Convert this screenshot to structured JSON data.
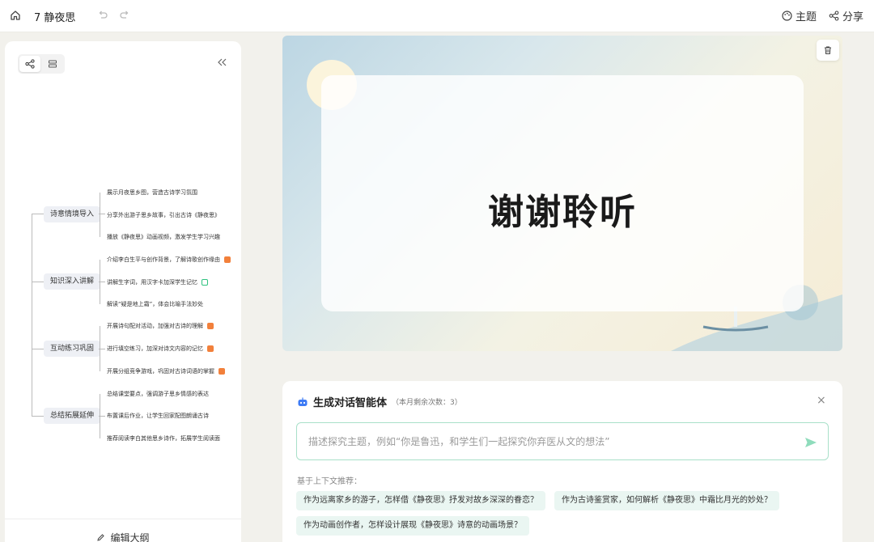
{
  "topbar": {
    "doc_title": "7 静夜思",
    "theme_label": "主题",
    "share_label": "分享"
  },
  "left_panel": {
    "edit_outline_label": "编辑大纲",
    "mindmap": {
      "branches": [
        {
          "label": "诗意情境导入",
          "leaves": [
            {
              "text": "展示月夜思乡图，营造古诗学习氛围",
              "badge": ""
            },
            {
              "text": "分享外出游子思乡故事，引出古诗《静夜思》",
              "badge": ""
            },
            {
              "text": "播放《静夜思》动画视频，激发学生学习兴趣",
              "badge": ""
            }
          ]
        },
        {
          "label": "知识深入讲解",
          "leaves": [
            {
              "text": "介绍李白生平与创作背景，了解诗歌创作缘由",
              "badge": "orange"
            },
            {
              "text": "讲解生字词，用汉字卡加深学生记忆",
              "badge": "green"
            },
            {
              "text": "解读“疑是地上霜”，体会比喻手法妙处",
              "badge": ""
            }
          ]
        },
        {
          "label": "互动练习巩固",
          "leaves": [
            {
              "text": "开展诗句配对活动，加强对古诗的理解",
              "badge": "orange"
            },
            {
              "text": "进行填空练习，加深对诗文内容的记忆",
              "badge": "orange"
            },
            {
              "text": "开展分组竞争游戏，巩固对古诗词语的掌握",
              "badge": "orange"
            }
          ]
        },
        {
          "label": "总结拓展延伸",
          "leaves": [
            {
              "text": "总结课堂要点，强调游子思乡情感的表达",
              "badge": ""
            },
            {
              "text": "布置课后作业，让学生回家配图朗诵古诗",
              "badge": ""
            },
            {
              "text": "推荐阅读李白其他思乡诗作，拓展学生阅读面",
              "badge": ""
            }
          ]
        }
      ]
    }
  },
  "slide": {
    "title": "谢谢聆听"
  },
  "agent": {
    "title": "生成对话智能体",
    "remaining": "（本月剩余次数：3）",
    "input_placeholder": "描述探究主题，例如“你是鲁迅，和学生们一起探究你弃医从文的想法”",
    "context_label": "基于上下文推荐：",
    "suggestions": [
      "作为远离家乡的游子，怎样借《静夜思》抒发对故乡深深的眷恋？",
      "作为古诗鉴赏家，如何解析《静夜思》中霜比月光的妙处？",
      "作为动画创作者，怎样设计展现《静夜思》诗意的动画场景？"
    ]
  },
  "colors": {
    "accent_green": "#2ec27e",
    "badge_orange": "#f2803b",
    "agent_icon_blue": "#3d7bf5"
  }
}
